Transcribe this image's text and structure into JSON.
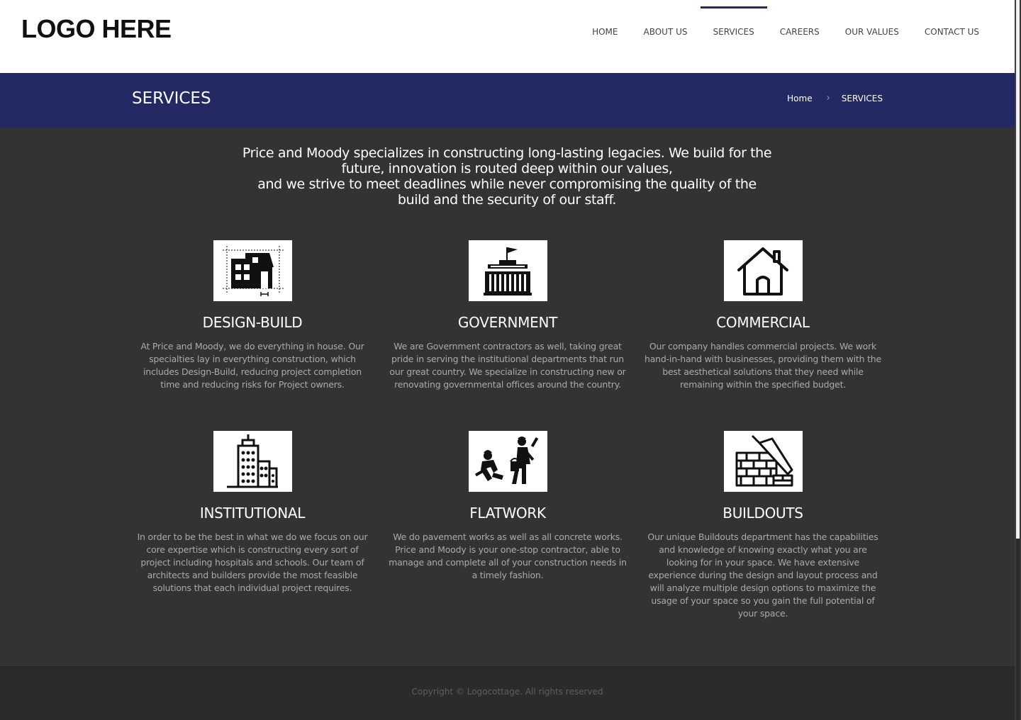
{
  "header": {
    "logo": "LOGO HERE",
    "nav": [
      {
        "label": "HOME",
        "active": false
      },
      {
        "label": "ABOUT US",
        "active": false
      },
      {
        "label": "SERVICES",
        "active": true
      },
      {
        "label": "CAREERS",
        "active": false
      },
      {
        "label": "OUR VALUES",
        "active": false
      },
      {
        "label": "CONTACT US",
        "active": false
      }
    ]
  },
  "titlebar": {
    "title": "SERVICES",
    "breadcrumb": {
      "home": "Home",
      "current": "SERVICES"
    }
  },
  "intro": {
    "line1": "Price and Moody specializes in constructing long-lasting legacies. We build for the future, innovation is routed deep within our values,",
    "line2": "and we strive to meet deadlines while never compromising the quality of the build and the security of our staff."
  },
  "services": [
    {
      "icon": "blueprint-house-icon",
      "title": "DESIGN-BUILD",
      "text": "At Price and Moody, we do everything in house. Our specialties lay in everything construction, which includes Design-Build, reducing project completion time and reducing risks for Project owners."
    },
    {
      "icon": "government-building-icon",
      "title": "GOVERNMENT",
      "text": "We are Government contractors as well, taking great pride in serving the institutional departments that run our great country. We specialize in constructing new or renovating governmental offices around the country."
    },
    {
      "icon": "house-icon",
      "title": "COMMERCIAL",
      "text": "Our company handles commercial projects. We work hand-in-hand with businesses, providing them with the best aesthetical solutions that they need while remaining within the specified budget."
    },
    {
      "icon": "city-buildings-icon",
      "title": "INSTITUTIONAL",
      "text": "In order to be the best in what we do we focus on our core expertise which is constructing every sort of project including hospitals and schools. Our team of architects and builders provide the most feasible solutions that each individual project requires."
    },
    {
      "icon": "workers-icon",
      "title": "FLATWORK",
      "text": "We do pavement works as well as all concrete works. Price and Moody is your one-stop contractor, able to manage and complete all of your construction needs in a timely fashion."
    },
    {
      "icon": "brick-trowel-icon",
      "title": "BUILDOUTS",
      "text": "Our unique Buildouts department has the capabilities and knowledge of knowing exactly what you are looking for in your space. We have extensive experience during the design and layout process and will analyze multiple design options to maximize the usage of your space so you gain the full potential of your space."
    }
  ],
  "footer": {
    "copyright": "Copyright © Logocottage. All rights reserved"
  },
  "colors": {
    "accent": "#232a63",
    "background": "#333333",
    "footer": "#2b2b2b"
  }
}
